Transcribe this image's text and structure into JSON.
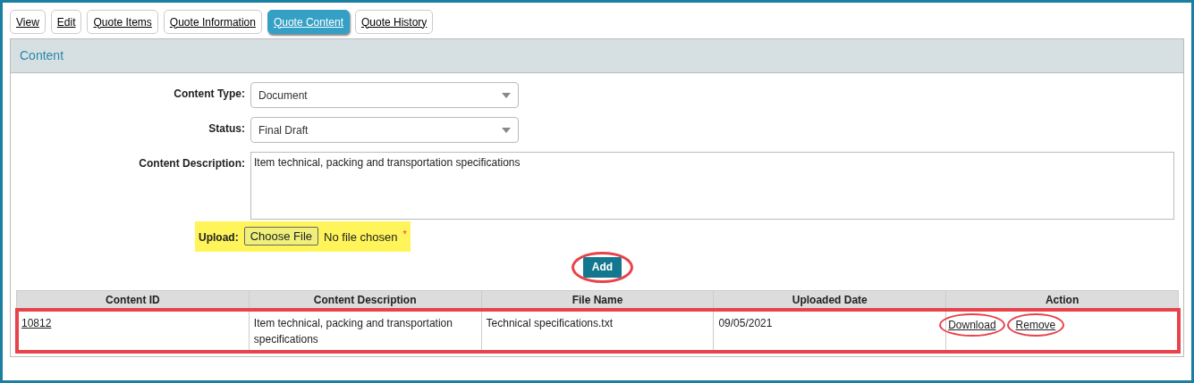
{
  "tabs": [
    {
      "label": "View",
      "selected": false
    },
    {
      "label": "Edit",
      "selected": false
    },
    {
      "label": "Quote Items",
      "selected": false
    },
    {
      "label": "Quote Information",
      "selected": false
    },
    {
      "label": "Quote Content",
      "selected": true
    },
    {
      "label": "Quote History",
      "selected": false
    }
  ],
  "panel": {
    "title": "Content",
    "fields": [
      {
        "kind": "select",
        "label": "Content Type:",
        "value": "Document"
      },
      {
        "kind": "select",
        "label": "Status:",
        "value": "Final Draft"
      },
      {
        "kind": "textarea",
        "label": "Content Description:",
        "value": "Item technical, packing and transportation specifications"
      }
    ],
    "upload": {
      "label": "Upload:",
      "button": "Choose File",
      "status": "No file chosen",
      "required_mark": "*",
      "highlighted": true
    },
    "add_button": {
      "label": "Add",
      "circled": true
    },
    "table": {
      "columns": [
        "Content ID",
        "Content Description",
        "File Name",
        "Uploaded Date",
        "Action"
      ],
      "rows": [
        {
          "id": "10812",
          "description": "Item technical, packing and transportation specifications",
          "file_name": "Technical specifications.txt",
          "uploaded_date": "09/05/2021",
          "outlined": true,
          "actions": [
            {
              "label": "Download",
              "circled": true
            },
            {
              "label": "Remove",
              "circled": true
            }
          ]
        }
      ]
    }
  }
}
